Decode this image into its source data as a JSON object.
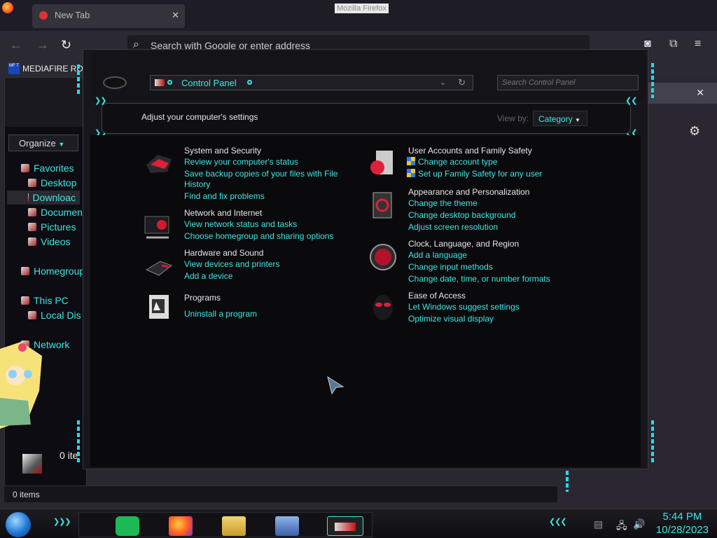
{
  "firefox": {
    "tab_title": "New Tab",
    "window_title": "Mozilla Firefox",
    "url_placeholder": "Search with Google or enter address",
    "bookmark": "MEDIAFIRE RO",
    "bookmark_icon_text": "MF T"
  },
  "explorer": {
    "organize": "Organize",
    "nav": {
      "favorites": "Favorites",
      "desktop": "Desktop",
      "downloads": "Downloac",
      "documents": "Documen",
      "pictures": "Pictures",
      "videos": "Videos",
      "homegroup": "Homegroup",
      "this_pc": "This PC",
      "local_disk": "Local Dis",
      "network": "Network"
    },
    "item_count_short": "0 ite",
    "status": "0 items"
  },
  "control_panel": {
    "breadcrumb": "Control Panel",
    "search_placeholder": "Search Control Panel",
    "heading": "Adjust your computer's settings",
    "view_by_label": "View by:",
    "view_by_value": "Category",
    "categories": {
      "system_security": {
        "title": "System and Security",
        "links": [
          "Review your computer's status",
          "Save backup copies of your files with File",
          "History",
          "Find and fix problems"
        ]
      },
      "network": {
        "title": "Network and Internet",
        "links": [
          "View network status and tasks",
          "Choose homegroup and sharing options"
        ]
      },
      "hardware": {
        "title": "Hardware and Sound",
        "links": [
          "View devices and printers",
          "Add a device"
        ]
      },
      "programs": {
        "title": "Programs",
        "links": [
          "Uninstall a program"
        ]
      },
      "user_accounts": {
        "title": "User Accounts and Family Safety",
        "links": [
          "Change account type",
          "Set up Family Safety for any user"
        ]
      },
      "appearance": {
        "title": "Appearance and Personalization",
        "links": [
          "Change the theme",
          "Change desktop background",
          "Adjust screen resolution"
        ]
      },
      "clock": {
        "title": "Clock, Language, and Region",
        "links": [
          "Add a language",
          "Change input methods",
          "Change date, time, or number formats"
        ]
      },
      "ease": {
        "title": "Ease of Access",
        "links": [
          "Let Windows suggest settings",
          "Optimize visual display"
        ]
      }
    }
  },
  "taskbar": {
    "time": "5:44 PM",
    "date": "10/28/2023"
  },
  "colors": {
    "accent": "#3ee6e0",
    "background": "#0a0a0d",
    "icon_red": "#d41a2a"
  }
}
